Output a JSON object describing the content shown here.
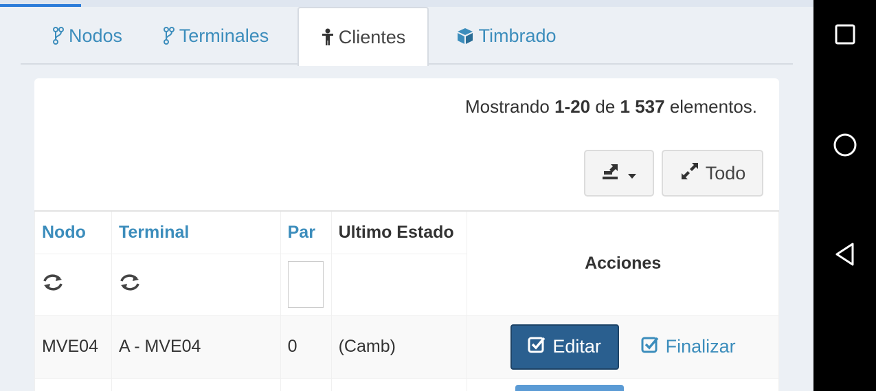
{
  "colors": {
    "accent": "#3c8dbc",
    "primary_button": "#2a5f8f",
    "page_bg": "#ecf0f5"
  },
  "progress": {
    "fraction": 0.1
  },
  "tabs": [
    {
      "label": "Nodos",
      "icon": "branch-icon"
    },
    {
      "label": "Terminales",
      "icon": "branch-icon"
    },
    {
      "label": "Clientes",
      "icon": "child-icon",
      "active": true
    },
    {
      "label": "Timbrado",
      "icon": "cube-icon"
    }
  ],
  "summary": {
    "prefix": "Mostrando ",
    "range": "1-20",
    "middle": " de ",
    "total": "1 537",
    "suffix": " elementos."
  },
  "toolbar": {
    "export_icon": "export-icon",
    "expand_label": "Todo"
  },
  "table": {
    "headers": {
      "nodo": "Nodo",
      "terminal": "Terminal",
      "par": "Par",
      "ultimo_estado": "Ultimo Estado",
      "acciones": "Acciones"
    },
    "rows": [
      {
        "nodo": "MVE04",
        "terminal": "A - MVE04",
        "par": "0",
        "ultimo_estado": "(Camb)",
        "edit_label": "Editar",
        "finalizar_label": "Finalizar"
      }
    ]
  }
}
